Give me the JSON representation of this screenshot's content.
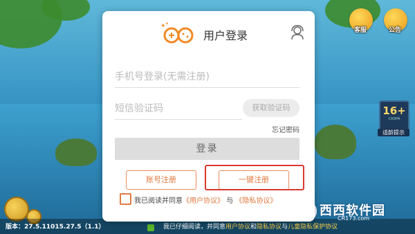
{
  "dialog": {
    "title": "用户登录",
    "phone_placeholder": "手机号登录(无需注册)",
    "sms_placeholder": "短信验证码",
    "get_code_button": "获取验证码",
    "forgot_password": "忘记密码",
    "login_button": "登录",
    "account_register_button": "账号注册",
    "onekey_register_button": "一键注册",
    "agreement": {
      "prefix": "我已阅读并同意",
      "user_agreement": "《用户协议》",
      "conjunction": "与",
      "privacy_policy": "《隐私协议》"
    }
  },
  "background": {
    "top_buttons": [
      {
        "label": "客服",
        "icon": "service-icon"
      },
      {
        "label": "公告",
        "icon": "announcement-icon"
      }
    ],
    "age_badge": {
      "rating": "16+",
      "sub": "CADPA",
      "label": "适龄提示"
    },
    "version": "版本：27.5.11015.27.5（1.1）",
    "bottom_notice": {
      "text": "我已仔细阅读，并同意",
      "link1": "用户协议",
      "mid": "和",
      "link2": "隐私协议",
      "mid2": "与",
      "link3": "儿童隐私保护协议"
    }
  },
  "watermark": {
    "name": "西西软件园",
    "url": "CR173.com"
  },
  "colors": {
    "accent": "#e07a40",
    "highlight": "#d9382f",
    "logo": "#f08a24"
  }
}
